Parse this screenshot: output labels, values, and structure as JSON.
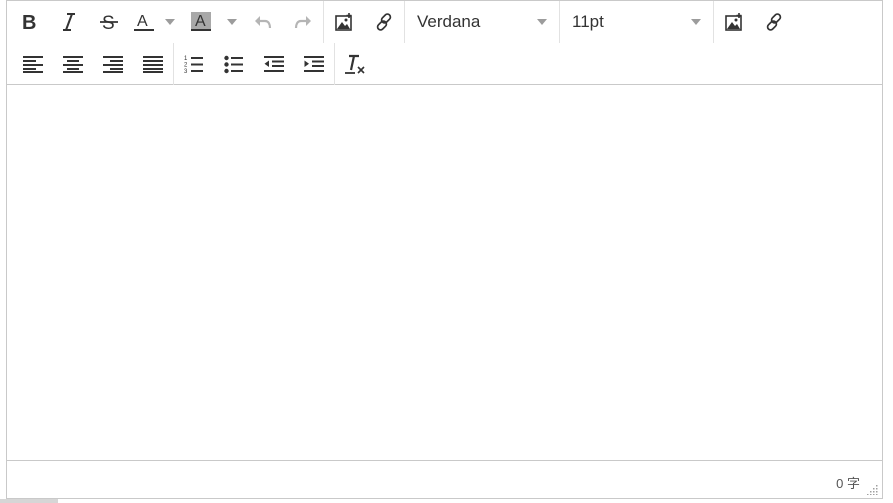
{
  "toolbar": {
    "font_family": "Verdana",
    "font_size": "11pt"
  },
  "statusbar": {
    "word_count": "0 字"
  },
  "icons": {
    "bold": "bold-icon",
    "italic": "italic-icon",
    "strikethrough": "strikethrough-icon",
    "text_color": "text-color-icon",
    "background_color": "background-color-icon",
    "undo": "undo-icon",
    "redo": "redo-icon",
    "image": "image-icon",
    "link": "link-icon",
    "align_left": "align-left-icon",
    "align_center": "align-center-icon",
    "align_right": "align-right-icon",
    "align_justify": "align-justify-icon",
    "numbered_list": "numbered-list-icon",
    "bullet_list": "bullet-list-icon",
    "outdent": "outdent-icon",
    "indent": "indent-icon",
    "clear_formatting": "clear-formatting-icon",
    "resize_handle": "resize-handle-icon"
  },
  "colors": {
    "icon": "#333333",
    "disabled_icon": "#b5b5b5",
    "border": "#c9c9c9",
    "caret": "#9c9c9c"
  }
}
